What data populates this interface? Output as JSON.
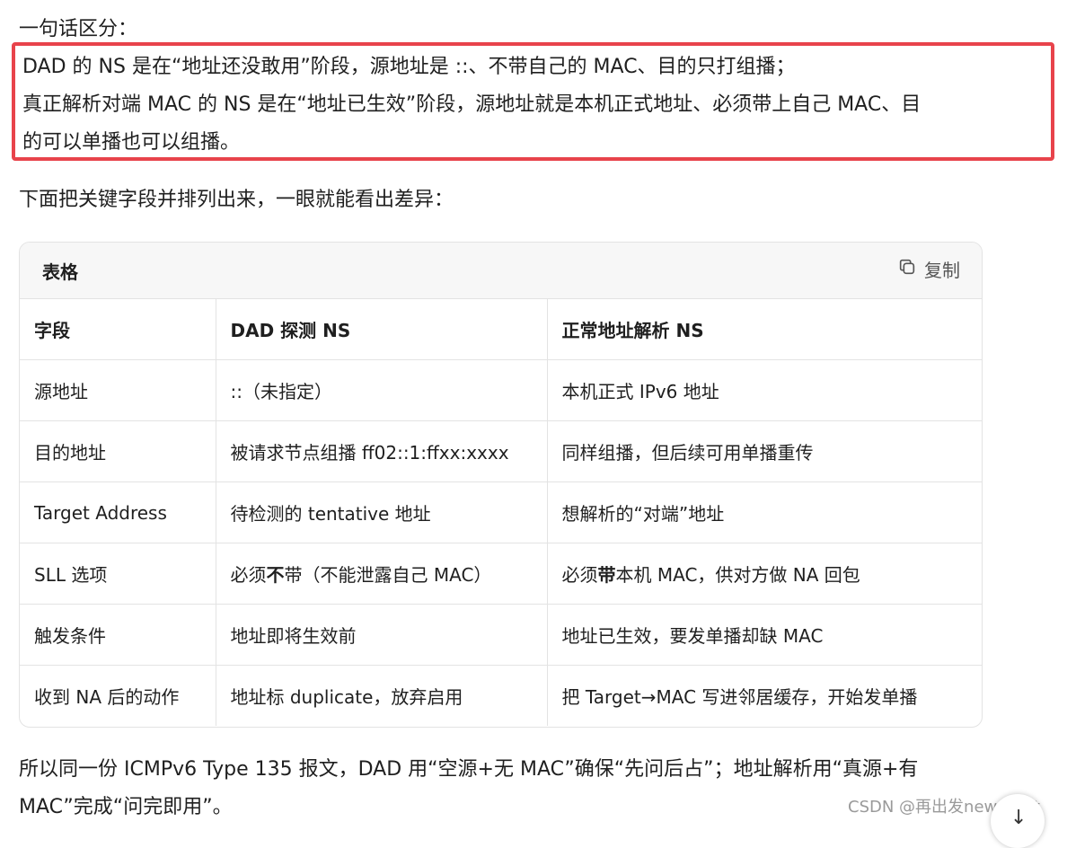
{
  "intro": "一句话区分：",
  "highlight": {
    "line1": "DAD 的 NS 是在“地址还没敢用”阶段，源地址是 ::、不带自己的 MAC、目的只打组播；",
    "line2": "真正解析对端 MAC 的 NS 是在“地址已生效”阶段，源地址就是本机正式地址、必须带上自己 MAC、目",
    "line3": "的可以单播也可以组播。"
  },
  "below": "下面把关键字段并排列出来，一眼就能看出差异：",
  "table": {
    "title": "表格",
    "copy_label": "复制",
    "copy_icon": "copy-icon",
    "headers": [
      "字段",
      "DAD 探测 NS",
      "正常地址解析 NS"
    ],
    "rows": [
      {
        "field": "源地址",
        "dad": "::（未指定）",
        "normal": "本机正式 IPv6 地址"
      },
      {
        "field": "目的地址",
        "dad": "被请求节点组播 ff02::1:ffxx:xxxx",
        "normal": "同样组播，但后续可用单播重传"
      },
      {
        "field": "Target Address",
        "dad": "待检测的 tentative 地址",
        "normal": "想解析的“对端”地址"
      },
      {
        "field": "SLL 选项",
        "dad_pre": "必须",
        "dad_bold": "不",
        "dad_post": "带（不能泄露自己 MAC）",
        "normal_pre": "必须",
        "normal_bold": "带",
        "normal_post": "本机 MAC，供对方做 NA 回包"
      },
      {
        "field": "触发条件",
        "dad": "地址即将生效前",
        "normal": "地址已生效，要发单播却缺 MAC"
      },
      {
        "field": "收到 NA 后的动作",
        "dad": "地址标 duplicate，放弃启用",
        "normal": "把 Target→MAC 写进邻居缓存，开始发单播"
      }
    ]
  },
  "footer": {
    "line1": "所以同一份 ICMPv6 Type 135 报文，DAD 用“空源+无 MAC”确保“先问后占”；地址解析用“真源+有",
    "line2": "MAC”完成“问完即用”。"
  },
  "watermark": "CSDN @再出发new start",
  "scroll_icon": "arrow-down-icon",
  "colors": {
    "highlight_border": "#e8434b",
    "table_header_bg": "#f7f7f7"
  }
}
